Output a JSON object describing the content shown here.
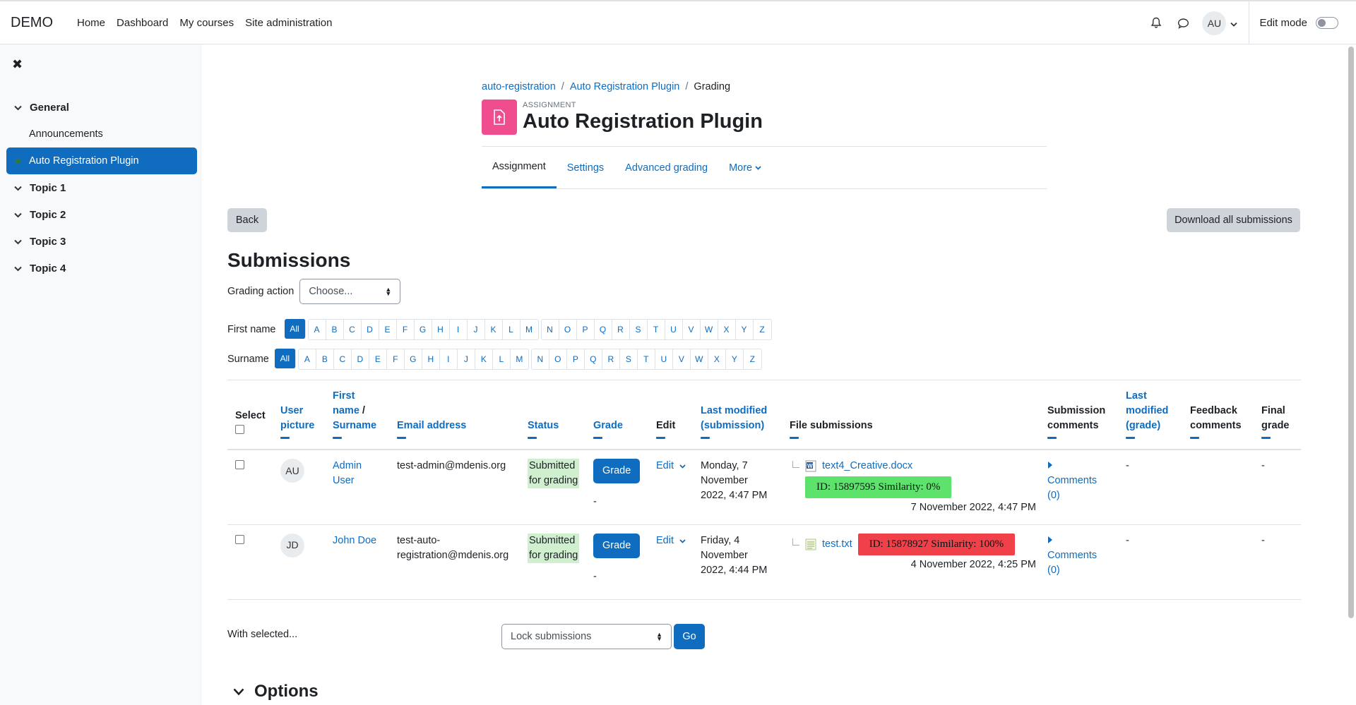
{
  "topnav": {
    "brand": "DEMO",
    "links": [
      "Home",
      "Dashboard",
      "My courses",
      "Site administration"
    ],
    "user_initials": "AU",
    "edit_mode_label": "Edit mode"
  },
  "drawer": {
    "sections": [
      {
        "label": "General",
        "items": [
          "Announcements",
          "Auto Registration Plugin"
        ]
      },
      {
        "label": "Topic 1"
      },
      {
        "label": "Topic 2"
      },
      {
        "label": "Topic 3"
      },
      {
        "label": "Topic 4"
      }
    ],
    "active_item": "Auto Registration Plugin"
  },
  "breadcrumb": [
    "auto-registration",
    "Auto Registration Plugin",
    "Grading"
  ],
  "activity": {
    "kind": "ASSIGNMENT",
    "title": "Auto Registration Plugin",
    "icon_color": "#ef4d8e"
  },
  "tabs": [
    "Assignment",
    "Settings",
    "Advanced grading",
    "More"
  ],
  "buttons": {
    "back": "Back",
    "download_all": "Download all submissions",
    "go": "Go"
  },
  "submissions_heading": "Submissions",
  "grading_action": {
    "label": "Grading action",
    "value": "Choose..."
  },
  "initials_bar": {
    "firstname_label": "First name",
    "surname_label": "Surname",
    "all": "All",
    "groups": [
      [
        "A",
        "B",
        "C",
        "D",
        "E",
        "F",
        "G",
        "H",
        "I",
        "J",
        "K",
        "L",
        "M"
      ],
      [
        "N",
        "O",
        "P",
        "Q",
        "R",
        "S",
        "T",
        "U",
        "V",
        "W",
        "X",
        "Y",
        "Z"
      ]
    ]
  },
  "table": {
    "headers": {
      "select": "Select",
      "user_picture": [
        "User",
        "picture"
      ],
      "name": [
        "First",
        "name",
        "/",
        "Surname"
      ],
      "email": "Email address",
      "status": "Status",
      "grade": "Grade",
      "edit": "Edit",
      "last_modified_sub": [
        "Last modified",
        "(submission)"
      ],
      "file_submissions": "File submissions",
      "submission_comments": [
        "Submission",
        "comments"
      ],
      "last_modified_grade": [
        "Last",
        "modified",
        "(grade)"
      ],
      "feedback_comments": [
        "Feedback",
        "comments"
      ],
      "final_grade": [
        "Final",
        "grade"
      ]
    },
    "rows": [
      {
        "initials": "AU",
        "name": [
          "Admin",
          "User"
        ],
        "email": [
          "test-admin@mdenis.org"
        ],
        "status": [
          "Submitted",
          "for grading"
        ],
        "grade_button": "Grade",
        "grade_value": "-",
        "edit": "Edit",
        "last_modified": [
          "Monday, 7",
          "November",
          "2022, 4:47 PM"
        ],
        "file_name": "text4_Creative.docx",
        "similarity": "ID: 15897595 Similarity: 0%",
        "similarity_color": "#5de36c",
        "file_date": "7 November 2022, 4:47 PM",
        "comments": [
          "Comments",
          "(0)"
        ],
        "last_modified_grade": "-",
        "final_grade": "-"
      },
      {
        "initials": "JD",
        "name": [
          "John Doe"
        ],
        "email": [
          "test-auto-",
          "registration@mdenis.org"
        ],
        "status": [
          "Submitted",
          "for grading"
        ],
        "grade_button": "Grade",
        "grade_value": "-",
        "edit": "Edit",
        "last_modified": [
          "Friday, 4",
          "November",
          "2022, 4:44 PM"
        ],
        "file_name": "test.txt",
        "similarity": "ID: 15878927 Similarity: 100%",
        "similarity_color": "#f0414a",
        "file_date": "4 November 2022, 4:25 PM",
        "comments": [
          "Comments",
          "(0)"
        ],
        "last_modified_grade": "-",
        "final_grade": "-"
      }
    ]
  },
  "with_selected": {
    "label": "With selected...",
    "action": "Lock submissions"
  },
  "options_heading": "Options"
}
